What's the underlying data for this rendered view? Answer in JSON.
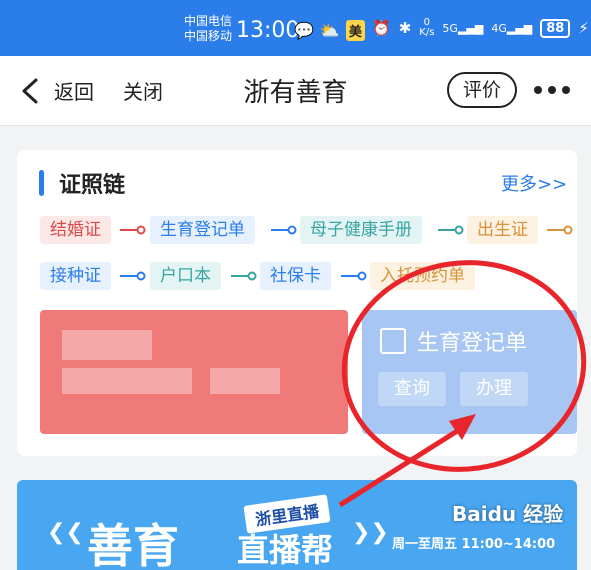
{
  "status_bar": {
    "carrier1": "中国电信",
    "carrier2": "中国移动",
    "time": "13:00",
    "badge_mei": "美",
    "speed_top": "0",
    "speed_unit": "K/s",
    "sig1": "5G",
    "sig2": "4G",
    "battery": "88"
  },
  "nav": {
    "back_label": "返回",
    "close_label": "关闭",
    "title": "浙有善育",
    "rate_label": "评价"
  },
  "card": {
    "title": "证照链",
    "more": "更多>>",
    "row1": [
      "结婚证",
      "生育登记单",
      "母子健康手册",
      "出生证"
    ],
    "row2": [
      "接种证",
      "户口本",
      "社保卡",
      "入托预约单"
    ],
    "cert_title": "生育登记单",
    "query_label": "查询",
    "handle_label": "办理"
  },
  "banner": {
    "tag": "浙里直播",
    "big": "善育",
    "mid": "直播帮",
    "time": "周一至周五 11:00~14:00"
  },
  "watermark": "Baidu 经验",
  "colors": {
    "primary": "#2b7de9",
    "annotation": "#e8252b"
  }
}
